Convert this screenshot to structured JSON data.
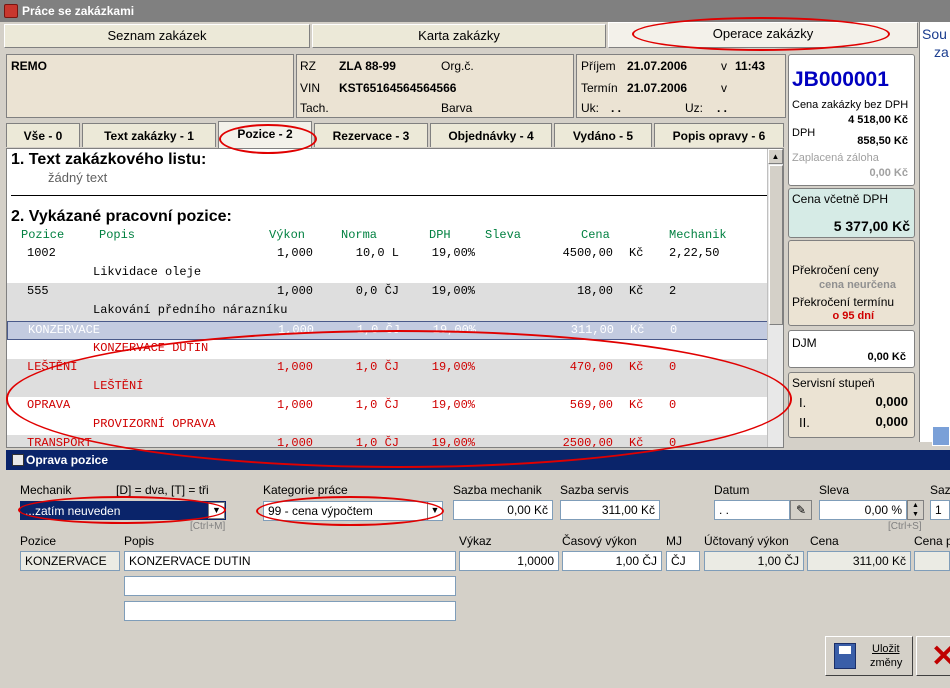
{
  "window": {
    "title": "Práce se zakázkami"
  },
  "main_tabs": [
    "Seznam zakázek",
    "Karta zakázky",
    "Operace zakázky"
  ],
  "right_edge": {
    "line1": "Sou",
    "line2": "za"
  },
  "customer": {
    "name": "REMO"
  },
  "vehicle": {
    "rz_label": "RZ",
    "rz": "ZLA 88-99",
    "org_label": "Org.č.",
    "vin_label": "VIN",
    "vin": "KST65164564564566",
    "tach_label": "Tach.",
    "barva_label": "Barva"
  },
  "dates": {
    "prijem_label": "Příjem",
    "prijem": "21.07.2006",
    "prijem_v": "v",
    "prijem_time": "11:43",
    "termin_label": "Termín",
    "termin": "21.07.2006",
    "termin_v": "v",
    "uk_label": "Uk:",
    "uk_val": ". .",
    "uz_label": "Uz:",
    "uz_val": ". ."
  },
  "sub_tabs": [
    "Vše - 0",
    "Text zakázky - 1",
    "Pozice - 2",
    "Rezervace - 3",
    "Objednávky - 4",
    "Vydáno - 5",
    "Popis opravy - 6"
  ],
  "section1": {
    "title": "1.  Text zakázkového listu:",
    "text": "žádný text"
  },
  "section2": {
    "title": "2.  Vykázané pracovní pozice:"
  },
  "columns": [
    "Pozice",
    "Popis",
    "Výkon",
    "Norma",
    "DPH",
    "Sleva",
    "Cena",
    "Mechanik"
  ],
  "positions": [
    {
      "pozice": "1002",
      "vykon": "1,000",
      "norma": "10,0 L",
      "dph": "19,00%",
      "cena": "4500,00",
      "kc": "Kč",
      "mech": "2,22,50",
      "popis": "Likvidace oleje",
      "style": "white"
    },
    {
      "pozice": "555",
      "vykon": "1,000",
      "norma": "0,0 ČJ",
      "dph": "19,00%",
      "cena": "18,00",
      "kc": "Kč",
      "mech": "2",
      "popis": "Lakování předního nárazníku",
      "style": "gray"
    },
    {
      "pozice": "KONZERVACE",
      "vykon": "1,000",
      "norma": "1,0 ČJ",
      "dph": "19,00%",
      "cena": "311,00",
      "kc": "Kč",
      "mech": "0",
      "popis": "KONZERVACE DUTIN",
      "style": "sel"
    },
    {
      "pozice": "LEŠTĚNÍ",
      "vykon": "1,000",
      "norma": "1,0 ČJ",
      "dph": "19,00%",
      "cena": "470,00",
      "kc": "Kč",
      "mech": "0",
      "popis": "LEŠTĚNÍ",
      "style": "gray"
    },
    {
      "pozice": "OPRAVA",
      "vykon": "1,000",
      "norma": "1,0 ČJ",
      "dph": "19,00%",
      "cena": "569,00",
      "kc": "Kč",
      "mech": "0",
      "popis": "PROVIZORNÍ OPRAVA",
      "style": "white"
    },
    {
      "pozice": "TRANSPORT",
      "vykon": "1,000",
      "norma": "1,0 ČJ",
      "dph": "19,00%",
      "cena": "2500,00",
      "kc": "Kč",
      "mech": "0",
      "popis": "",
      "style": "gray"
    }
  ],
  "summary": {
    "order_id": "JB000001",
    "bez_dph_label": "Cena zakázky bez DPH",
    "bez_dph": "4 518,00 Kč",
    "dph_label": "DPH",
    "dph": "858,50 Kč",
    "zaloha_label": "Zaplacená záloha",
    "zaloha": "0,00 Kč",
    "vc_dph_label": "Cena včetně DPH",
    "vc_dph": "5 377,00 Kč",
    "prekroceni_ceny_label": "Překročení ceny",
    "prekroceni_ceny": "cena neurčena",
    "prekroceni_terminu_label": "Překročení termínu",
    "prekroceni_terminu": "o 95 dní",
    "djm_label": "DJM",
    "djm": "0,00 Kč",
    "servis_label": "Servisní stupeň",
    "servis_i_label": "I.",
    "servis_i": "0,000",
    "servis_ii_label": "II.",
    "servis_ii": "0,000"
  },
  "dialog": {
    "title": "Oprava pozice",
    "mechanik_label": "Mechanik",
    "mechanik_hint": "[D] = dva, [T] = tři",
    "mechanik_value": "...zatím neuveden",
    "mechanik_shortcut": "[Ctrl+M]",
    "kategorie_label": "Kategorie práce",
    "kategorie_value": "99 - cena výpočtem",
    "sazba_mech_label": "Sazba mechanik",
    "sazba_mech": "0,00 Kč",
    "sazba_serv_label": "Sazba servis",
    "sazba_serv": "311,00 Kč",
    "datum_label": "Datum",
    "datum": ". .",
    "sleva_label": "Sleva",
    "sleva": "0,00 %",
    "sleva_shortcut": "[Ctrl+S]",
    "sazb_label": "Sazb",
    "sazb_val": "1",
    "pozice_label": "Pozice",
    "pozice": "KONZERVACE",
    "popis_label": "Popis",
    "popis": "KONZERVACE DUTIN",
    "popis2": "",
    "popis3": "",
    "vykaz_label": "Výkaz",
    "vykaz": "1,0000",
    "casovy_label": "Časový výkon",
    "casovy": "1,00 ČJ",
    "mj_label": "MJ",
    "mj": "ČJ",
    "uctovany_label": "Účtovaný výkon",
    "uctovany": "1,00 ČJ",
    "cena_label": "Cena",
    "cena": "311,00 Kč",
    "cena_p_label": "Cena p",
    "save_label_1": "Uložit",
    "save_label_2": "změny"
  },
  "colors": {
    "accent_blue": "#0a246a",
    "red_text": "#d00000",
    "annotation": "#e00000",
    "green_col": "#008040"
  }
}
